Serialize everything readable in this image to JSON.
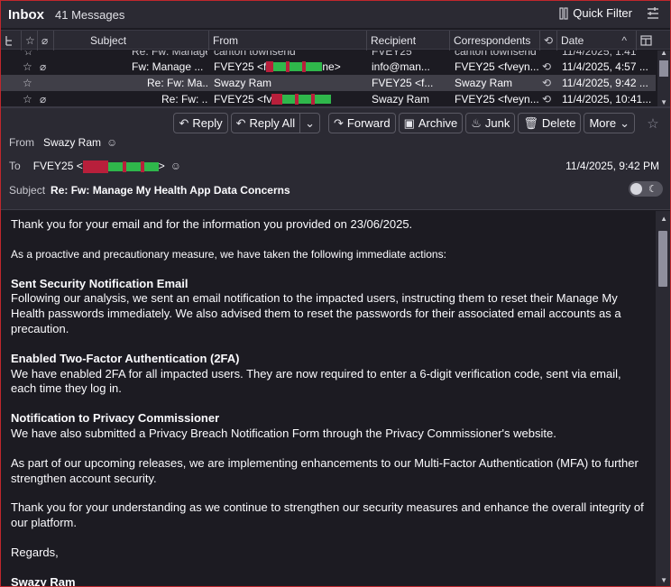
{
  "topbar": {
    "folder": "Inbox",
    "count": "41 Messages",
    "quick_filter": "Quick Filter"
  },
  "columns": {
    "subject": "Subject",
    "from": "From",
    "recipient": "Recipient",
    "correspondents": "Correspondents",
    "date": "Date"
  },
  "threads": [
    {
      "subject": "Re: Fw: Manage ...",
      "from": "carlton townsend",
      "recipient": "FVEY25",
      "correspondents": "carlton townsend",
      "date": "11/4/2025, 1:41"
    },
    {
      "subject": "Fw: Manage ...",
      "from": "FVEY25 <f",
      "from_tail": "ne>",
      "recipient": "info@man...",
      "correspondents": "FVEY25 <fveyn...",
      "date": "11/4/2025, 4:57 ..."
    },
    {
      "subject": "Re: Fw: Ma...",
      "from": "Swazy Ram",
      "recipient": "FVEY25 <f...",
      "correspondents": "Swazy Ram",
      "date": "11/4/2025, 9:42 ..."
    },
    {
      "subject": "Re: Fw: ...",
      "from": "FVEY25 <fv",
      "recipient": "Swazy Ram",
      "correspondents": "FVEY25 <fveyn...",
      "date": "11/4/2025, 10:41..."
    }
  ],
  "toolbar": {
    "reply": "Reply",
    "reply_all": "Reply All",
    "forward": "Forward",
    "archive": "Archive",
    "junk": "Junk",
    "delete": "Delete",
    "more": "More"
  },
  "header": {
    "from_label": "From",
    "from_value": "Swazy Ram",
    "to_label": "To",
    "to_value": "FVEY25 <",
    "to_tail": ">",
    "date": "11/4/2025, 9:42 PM",
    "subject_label": "Subject",
    "subject_value": "Re: Fw: Manage My Health App Data Concerns"
  },
  "body": {
    "p1": "Thank you for your email and for the information you provided on 23/06/2025.",
    "p2": "As a proactive and precautionary measure, we have taken the following immediate actions:",
    "h1": "Sent Security Notification Email",
    "p3": "Following our analysis, we sent an email notification to the impacted users, instructing them to reset their Manage My Health passwords immediately. We also advised them to reset the passwords for their associated email accounts as a precaution.",
    "h2": "Enabled Two-Factor Authentication (2FA)",
    "p4": "We have enabled 2FA for all impacted users. They are now required to enter a 6-digit verification code, sent via email, each time they log in.",
    "h3": "Notification to Privacy Commissioner",
    "p5": "We have also submitted a Privacy Breach Notification Form through the Privacy Commissioner's website.",
    "p6": "As part of our upcoming releases, we are implementing enhancements to our Multi-Factor Authentication (MFA) to further strengthen account security.",
    "p7": "Thank you for your understanding as we continue to strengthen our security measures and enhance the overall integrity of our platform.",
    "p8": "Regards,",
    "sig": "Swazy Ram"
  },
  "colors": {
    "background": "#1c1b22",
    "panel": "#2b2a33",
    "frame_border": "#c0272d",
    "redaction_red": "#b81f3b",
    "redaction_green": "#2fb74b"
  }
}
